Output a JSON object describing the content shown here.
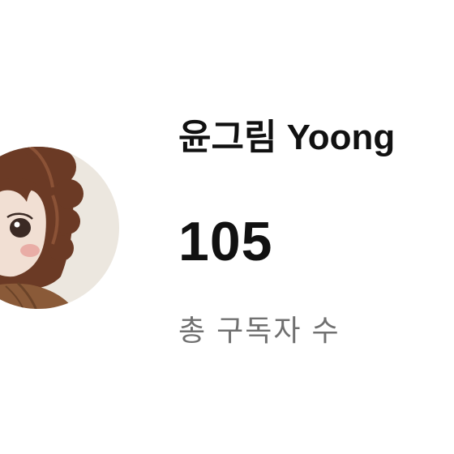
{
  "profile": {
    "channel_name": "윤그림 Yoong",
    "subscriber_count": "105",
    "subscriber_label": "총 구독자 수"
  },
  "colors": {
    "avatar_background": "#ece7df",
    "hair": "#6b3a25",
    "jacket": "#8a5a38",
    "text_primary": "#111111",
    "text_secondary": "#707070"
  }
}
